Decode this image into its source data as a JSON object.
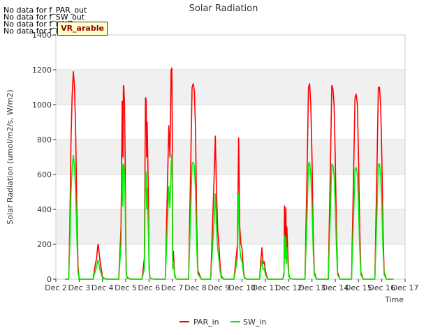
{
  "no_data_lines": [
    "No data for f_PAR_out",
    "No data for f_SW_out",
    "No data for f_LW_in",
    "No data for f_LW_out"
  ],
  "badge": "VR_arable",
  "chart_data": {
    "type": "line",
    "title": "Solar Radiation",
    "xlabel": "Time",
    "ylabel": "Solar Radiation (umol/m2/s, W/m2)",
    "xlim": [
      2,
      17
    ],
    "ylim": [
      0,
      1400
    ],
    "x_ticks": [
      "Dec 2",
      "Dec 3",
      "Dec 4",
      "Dec 5",
      "Dec 6",
      "Dec 7",
      "Dec 8",
      "Dec 9",
      "Dec 10",
      "Dec 11",
      "Dec 12",
      "Dec 13",
      "Dec 14",
      "Dec 15",
      "Dec 16",
      "Dec 17"
    ],
    "y_ticks": [
      0,
      200,
      400,
      600,
      800,
      1000,
      1200,
      1400
    ],
    "grid": true,
    "legend_position": "bottom-center",
    "colors": {
      "PAR_in": "#ff0000",
      "SW_in": "#00ee00",
      "band": "#f0f0f0"
    },
    "series": [
      {
        "name": "PAR_in",
        "x": [
          2.4,
          2.55,
          2.6,
          2.65,
          2.7,
          2.75,
          2.8,
          2.85,
          2.9,
          2.95,
          3.0,
          3.15,
          3.4,
          3.6,
          3.7,
          3.75,
          3.8,
          3.82,
          3.85,
          3.9,
          3.95,
          4.0,
          4.15,
          4.4,
          4.7,
          4.8,
          4.85,
          4.88,
          4.9,
          4.92,
          4.95,
          4.98,
          5.0,
          5.02,
          5.05,
          5.2,
          5.4,
          5.7,
          5.8,
          5.85,
          5.88,
          5.9,
          5.92,
          5.95,
          5.98,
          6.0,
          6.02,
          6.05,
          6.2,
          6.4,
          6.7,
          6.85,
          6.9,
          6.95,
          6.98,
          7.0,
          7.02,
          7.05,
          7.1,
          7.15,
          7.2,
          7.4,
          7.7,
          7.8,
          7.85,
          7.9,
          7.95,
          8.0,
          8.05,
          8.1,
          8.25,
          8.4,
          8.65,
          8.8,
          8.85,
          8.9,
          8.95,
          9.0,
          9.05,
          9.1,
          9.2,
          9.4,
          9.65,
          9.8,
          9.85,
          9.9,
          9.95,
          10.0,
          10.05,
          10.1,
          10.2,
          10.4,
          10.75,
          10.8,
          10.85,
          10.9,
          10.95,
          11.0,
          11.05,
          11.1,
          11.2,
          11.4,
          11.75,
          11.8,
          11.82,
          11.85,
          11.88,
          11.9,
          11.92,
          11.95,
          11.98,
          12.0,
          12.05,
          12.2,
          12.4,
          12.7,
          12.8,
          12.85,
          12.9,
          12.95,
          13.0,
          13.05,
          13.1,
          13.2,
          13.4,
          13.7,
          13.8,
          13.85,
          13.9,
          13.95,
          14.0,
          14.05,
          14.1,
          14.2,
          14.4,
          14.7,
          14.8,
          14.85,
          14.9,
          14.95,
          15.0,
          15.05,
          15.1,
          15.2,
          15.4,
          15.7,
          15.8,
          15.85,
          15.9,
          15.95,
          16.0,
          16.05,
          16.1,
          16.2,
          16.5
        ],
        "values": [
          0,
          0,
          300,
          800,
          1050,
          1190,
          1100,
          850,
          400,
          80,
          0,
          0,
          0,
          0,
          90,
          120,
          190,
          200,
          160,
          100,
          60,
          10,
          0,
          0,
          0,
          300,
          1020,
          700,
          1110,
          1100,
          1000,
          660,
          300,
          50,
          10,
          0,
          0,
          0,
          120,
          1040,
          1030,
          700,
          900,
          670,
          400,
          120,
          30,
          5,
          0,
          0,
          0,
          880,
          700,
          1200,
          1210,
          800,
          100,
          160,
          30,
          5,
          0,
          0,
          0,
          700,
          1100,
          1120,
          1080,
          850,
          300,
          50,
          0,
          0,
          0,
          600,
          820,
          500,
          280,
          200,
          90,
          20,
          0,
          0,
          0,
          200,
          810,
          300,
          200,
          170,
          60,
          10,
          0,
          0,
          0,
          100,
          180,
          90,
          100,
          50,
          20,
          0,
          0,
          0,
          0,
          40,
          420,
          200,
          410,
          150,
          300,
          200,
          100,
          30,
          5,
          0,
          0,
          0,
          700,
          1100,
          1120,
          1000,
          700,
          300,
          40,
          0,
          0,
          0,
          700,
          1110,
          1090,
          1000,
          700,
          300,
          40,
          0,
          0,
          0,
          700,
          1040,
          1060,
          1000,
          700,
          300,
          40,
          0,
          0,
          0,
          700,
          1100,
          1100,
          1000,
          700,
          300,
          40,
          0,
          0
        ]
      },
      {
        "name": "SW_in",
        "x": [
          2.4,
          2.55,
          2.6,
          2.65,
          2.7,
          2.75,
          2.8,
          2.85,
          2.9,
          2.95,
          3.0,
          3.15,
          3.4,
          3.6,
          3.7,
          3.75,
          3.8,
          3.82,
          3.85,
          3.9,
          3.95,
          4.0,
          4.15,
          4.4,
          4.7,
          4.8,
          4.85,
          4.88,
          4.9,
          4.92,
          4.95,
          4.98,
          5.0,
          5.02,
          5.05,
          5.2,
          5.4,
          5.7,
          5.8,
          5.85,
          5.88,
          5.9,
          5.92,
          5.95,
          5.98,
          6.0,
          6.02,
          6.05,
          6.2,
          6.4,
          6.7,
          6.85,
          6.9,
          6.95,
          6.98,
          7.0,
          7.02,
          7.05,
          7.1,
          7.15,
          7.2,
          7.4,
          7.7,
          7.8,
          7.85,
          7.9,
          7.95,
          8.0,
          8.05,
          8.1,
          8.25,
          8.4,
          8.65,
          8.8,
          8.85,
          8.9,
          8.95,
          9.0,
          9.05,
          9.1,
          9.2,
          9.4,
          9.65,
          9.8,
          9.85,
          9.9,
          9.95,
          10.0,
          10.05,
          10.1,
          10.2,
          10.4,
          10.75,
          10.8,
          10.85,
          10.9,
          10.95,
          11.0,
          11.05,
          11.1,
          11.2,
          11.4,
          11.75,
          11.8,
          11.82,
          11.85,
          11.88,
          11.9,
          11.92,
          11.95,
          11.98,
          12.0,
          12.05,
          12.2,
          12.4,
          12.7,
          12.8,
          12.85,
          12.9,
          12.95,
          13.0,
          13.05,
          13.1,
          13.2,
          13.4,
          13.7,
          13.8,
          13.85,
          13.9,
          13.95,
          14.0,
          14.05,
          14.1,
          14.2,
          14.4,
          14.7,
          14.8,
          14.85,
          14.9,
          14.95,
          15.0,
          15.05,
          15.1,
          15.2,
          15.4,
          15.7,
          15.8,
          15.85,
          15.9,
          15.95,
          16.0,
          16.05,
          16.1,
          16.2,
          16.5
        ],
        "values": [
          0,
          0,
          200,
          500,
          640,
          710,
          650,
          500,
          250,
          40,
          0,
          0,
          0,
          0,
          50,
          70,
          110,
          100,
          90,
          50,
          30,
          5,
          0,
          0,
          0,
          200,
          660,
          420,
          660,
          650,
          600,
          400,
          180,
          30,
          5,
          0,
          0,
          0,
          60,
          620,
          610,
          400,
          520,
          400,
          240,
          70,
          20,
          3,
          0,
          0,
          0,
          530,
          410,
          650,
          720,
          480,
          60,
          100,
          20,
          3,
          0,
          0,
          0,
          420,
          660,
          670,
          650,
          500,
          180,
          30,
          0,
          0,
          0,
          350,
          490,
          300,
          170,
          120,
          50,
          10,
          0,
          0,
          0,
          120,
          490,
          180,
          120,
          100,
          40,
          5,
          0,
          0,
          0,
          60,
          110,
          55,
          60,
          30,
          10,
          0,
          0,
          0,
          0,
          25,
          250,
          120,
          240,
          90,
          180,
          120,
          60,
          20,
          3,
          0,
          0,
          0,
          420,
          660,
          670,
          600,
          420,
          180,
          25,
          0,
          0,
          0,
          420,
          660,
          650,
          600,
          420,
          180,
          25,
          0,
          0,
          0,
          420,
          630,
          640,
          600,
          420,
          180,
          25,
          0,
          0,
          0,
          420,
          660,
          660,
          600,
          420,
          180,
          25,
          0,
          0
        ]
      }
    ]
  }
}
